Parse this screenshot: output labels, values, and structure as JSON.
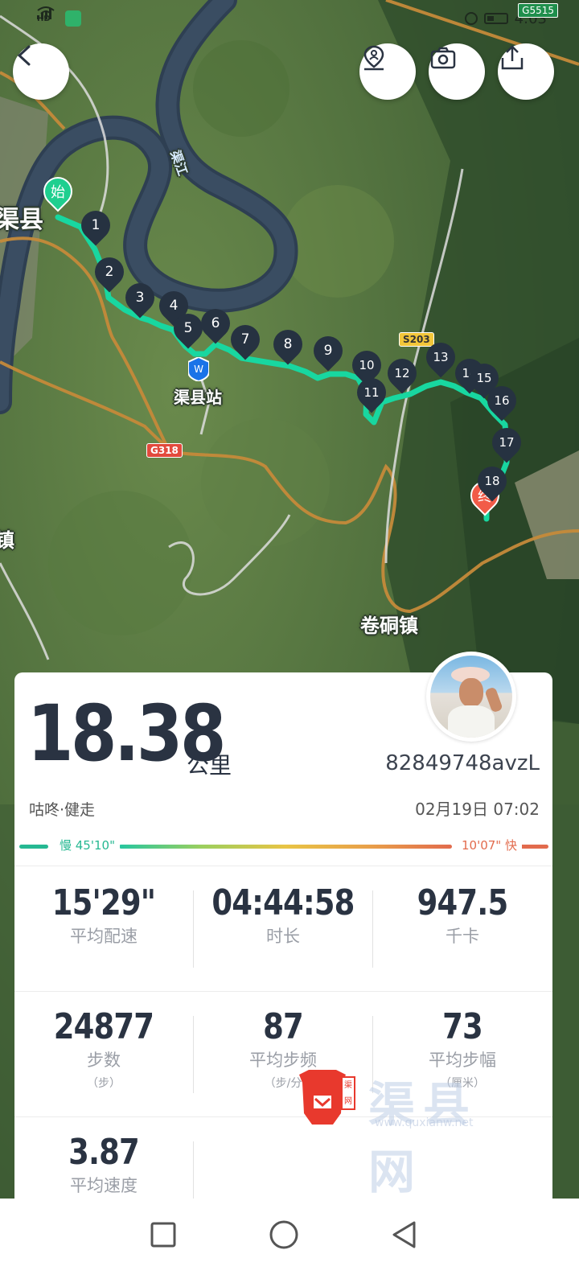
{
  "status_bar": {
    "left": [
      "HD",
      "4G",
      "wifi",
      "app-icon"
    ],
    "time": "4:03",
    "road_badge": "G5515"
  },
  "map": {
    "labels": {
      "town_west": "渠县",
      "station": "渠县站",
      "river": "渠江",
      "town_south": "卷硐镇",
      "town_left_edge": "镇"
    },
    "road_badges": {
      "g318": "G318",
      "s203": "S203"
    },
    "start_marker": "始",
    "end_marker": "终",
    "checkpoints": [
      "1",
      "2",
      "3",
      "4",
      "5",
      "6",
      "7",
      "8",
      "9",
      "10",
      "11",
      "12",
      "13",
      "14",
      "15",
      "16",
      "17",
      "18"
    ],
    "colors": {
      "route": "#18d7a0",
      "checkpoint": "#263241",
      "start": "#1fcf8f",
      "end": "#f25b48"
    }
  },
  "toolbar": {
    "back_icon": "chevron-left-icon",
    "location_icon": "location-person-icon",
    "camera_icon": "camera-icon",
    "share_icon": "share-icon"
  },
  "summary": {
    "distance": "18.38",
    "unit": "公里",
    "username": "82849748avzL",
    "sport_type": "咕咚·健走",
    "datetime": "02月19日 07:02",
    "pace_slow": "慢 45'10\"",
    "pace_fast": "10'07\" 快"
  },
  "stats": [
    {
      "value": "15'29\"",
      "label": "平均配速",
      "sub": ""
    },
    {
      "value": "04:44:58",
      "label": "时长",
      "sub": ""
    },
    {
      "value": "947.5",
      "label": "千卡",
      "sub": ""
    },
    {
      "value": "24877",
      "label": "步数",
      "sub": "（步）"
    },
    {
      "value": "87",
      "label": "平均步频",
      "sub": "（步/分"
    },
    {
      "value": "73",
      "label": "平均步幅",
      "sub": "（厘米）"
    },
    {
      "value": "3.87",
      "label": "平均速度",
      "sub": ""
    }
  ],
  "watermark": {
    "text": "渠县网",
    "url": "www.quxianw.net",
    "seal": "渠网"
  },
  "navbar": {
    "square_icon": "recent-apps-icon",
    "circle_icon": "home-icon",
    "triangle_icon": "back-triangle-icon"
  }
}
